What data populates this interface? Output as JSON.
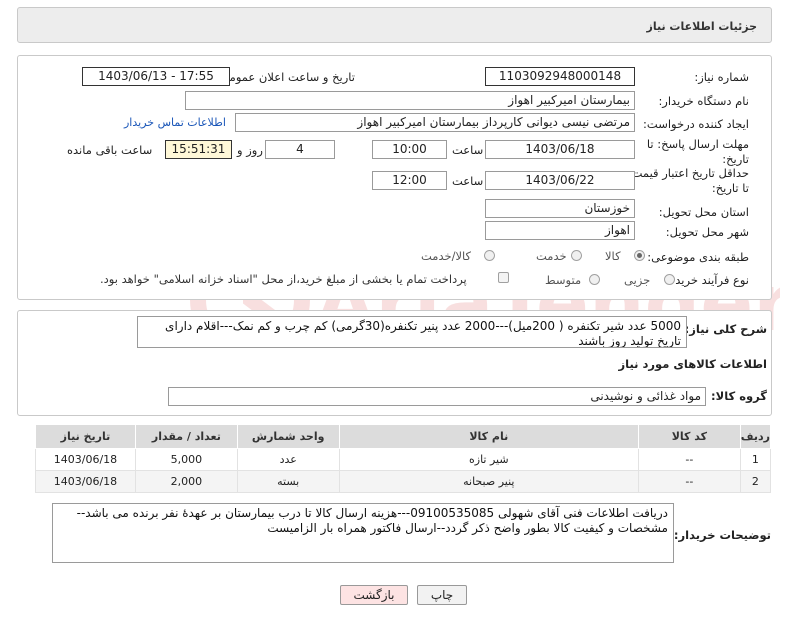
{
  "header": {
    "title": "جزئیات اطلاعات نیاز"
  },
  "form": {
    "need_number_label": "شماره نیاز:",
    "need_number": "1103092948000148",
    "announce_label": "تاریخ و ساعت اعلان عمومی:",
    "announce_value": "1403/06/13 - 17:55",
    "buyer_org_label": "نام دستگاه خریدار:",
    "buyer_org": "بیمارستان امیرکبیر اهواز",
    "creator_label": "ایجاد کننده درخواست:",
    "creator": "مرتضی نیسی دیوانی کارپرداز بیمارستان امیرکبیر اهواز",
    "contact_link": "اطلاعات تماس خریدار",
    "deadline_label": "مهلت ارسال پاسخ: تا تاریخ:",
    "deadline_date": "1403/06/18",
    "time_label": "ساعت",
    "deadline_time": "10:00",
    "days_value": "4",
    "days_label": "روز و",
    "remaining_time": "15:51:31",
    "remaining_label": "ساعت باقی مانده",
    "validity_label": "حداقل تاریخ اعتبار قیمت: تا تاریخ:",
    "validity_date": "1403/06/22",
    "validity_time": "12:00",
    "province_label": "استان محل تحویل:",
    "province": "خوزستان",
    "city_label": "شهر محل تحویل:",
    "city": "اهواز",
    "category_label": "طبقه بندی موضوعی:",
    "category_options": [
      "کالا",
      "خدمت",
      "کالا/خدمت"
    ],
    "category_selected": "کالا",
    "process_label": "نوع فرآیند خرید :",
    "process_options": [
      "جزیی",
      "متوسط"
    ],
    "process_selected": "جزیی",
    "treasury_note": "پرداخت تمام یا بخشی از مبلغ خرید،از محل \"اسناد خزانه اسلامی\" خواهد بود."
  },
  "description": {
    "label": "شرح کلی نیاز:",
    "text": "5000 عدد شیر تکنفره ( 200میل)---2000 عدد پنیر تکنفره(30گرمی) کم چرب و کم نمک---اقلام دارای تاریخ تولید روز باشند"
  },
  "goods": {
    "section_title": "اطلاعات کالاهای مورد نیاز",
    "group_label": "گروه کالا:",
    "group_value": "مواد غذائی و نوشیدنی",
    "columns": [
      "ردیف",
      "کد کالا",
      "نام کالا",
      "واحد شمارش",
      "تعداد / مقدار",
      "تاریخ نیاز"
    ],
    "rows": [
      {
        "row": "1",
        "code": "--",
        "name": "شیر تازه",
        "unit": "عدد",
        "qty": "5,000",
        "date": "1403/06/18"
      },
      {
        "row": "2",
        "code": "--",
        "name": "پنیر صبحانه",
        "unit": "بسته",
        "qty": "2,000",
        "date": "1403/06/18"
      }
    ]
  },
  "notes": {
    "label": "توضیحات خریدار:",
    "text": "دریافت اطلاعات فنی آقای شهولی 09100535085---هزینه ارسال کالا تا درب بیمارستان بر عهدۀ نفر برنده می باشد--مشخصات و کیفیت کالا بطور واضح ذکر گردد--ارسال فاکتور همراه بار الزامیست"
  },
  "buttons": {
    "print": "چاپ",
    "back": "بازگشت"
  },
  "colors": {
    "link": "#1a56b8",
    "print_bg": "#f2f2f2",
    "back_bg": "#fde3e3"
  },
  "watermark_text": "AriaTender.net"
}
